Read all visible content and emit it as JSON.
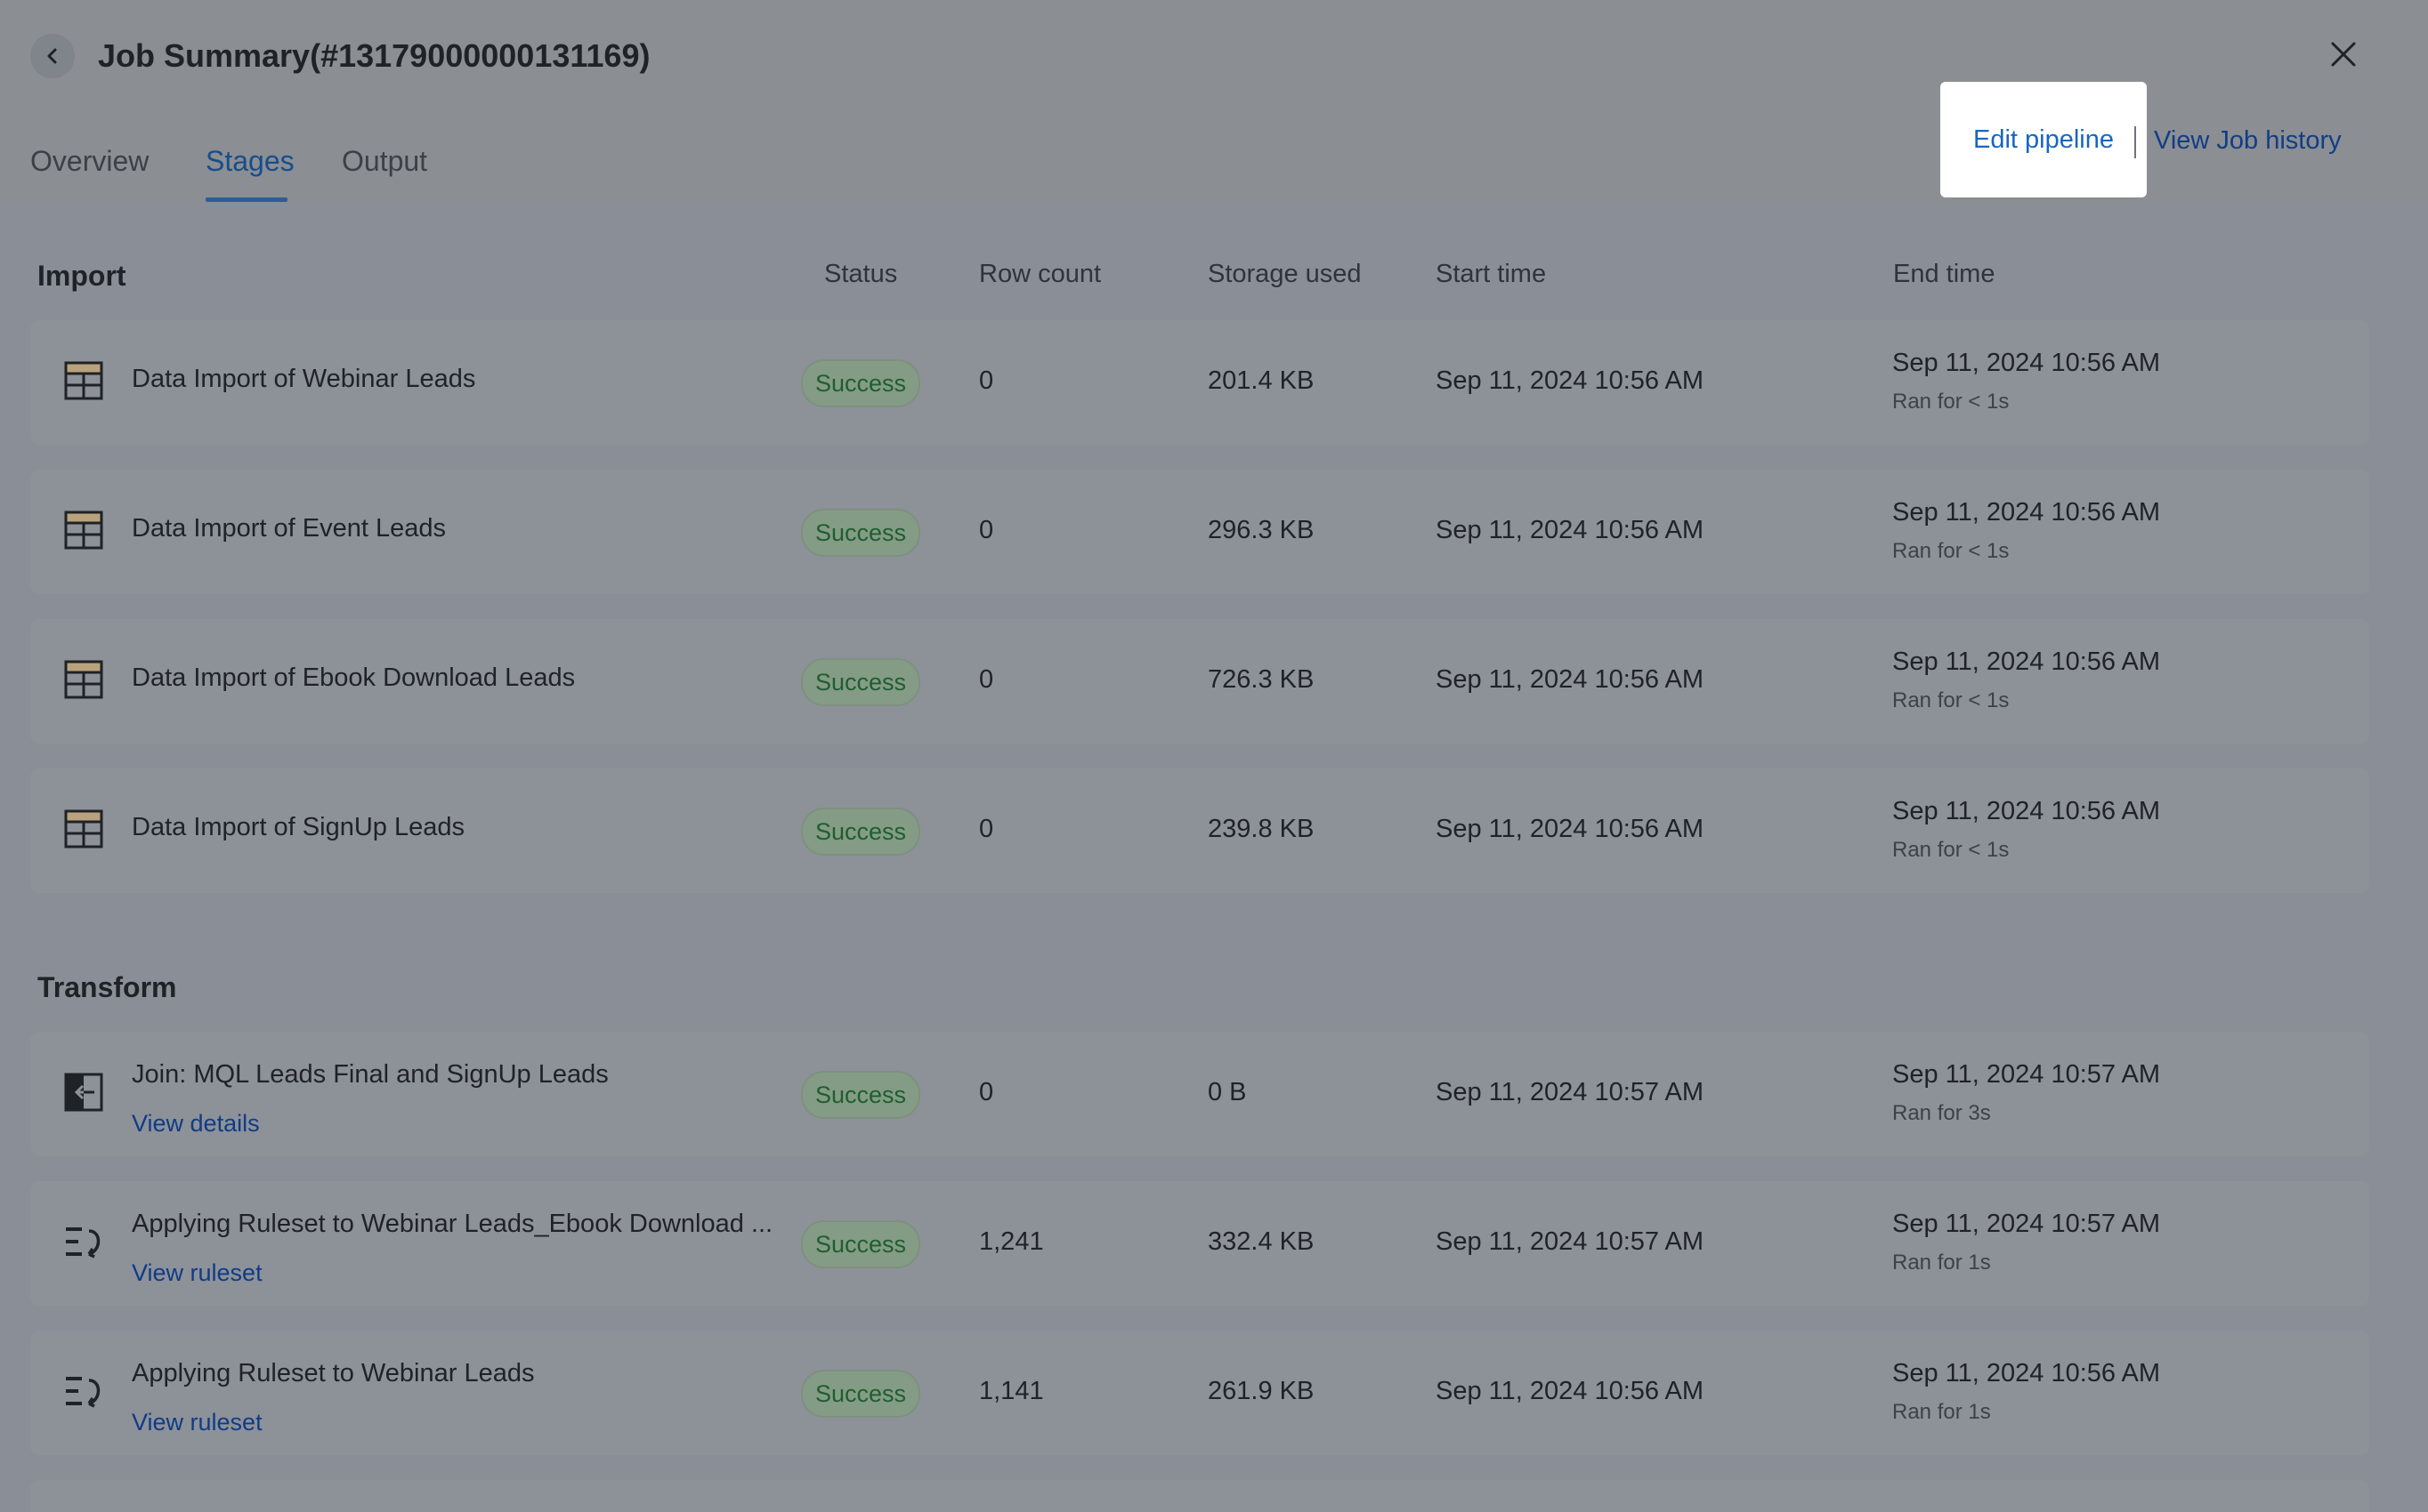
{
  "header": {
    "title": "Job Summary(#13179000000131169)",
    "tabs": [
      "Overview",
      "Stages",
      "Output"
    ],
    "active_tab": "Stages",
    "edit_pipeline": "Edit pipeline",
    "view_job_history": "View Job history"
  },
  "columns": {
    "status": "Status",
    "row_count": "Row count",
    "storage_used": "Storage used",
    "start_time": "Start time",
    "end_time": "End time"
  },
  "import": {
    "title": "Import",
    "rows": [
      {
        "icon": "table-icon",
        "name": "Data Import of Webinar Leads",
        "status": "Success",
        "row_count": "0",
        "storage": "201.4 KB",
        "start": "Sep 11, 2024 10:56 AM",
        "end": "Sep 11, 2024 10:56 AM",
        "ran_for": "Ran for < 1s"
      },
      {
        "icon": "table-icon",
        "name": "Data Import of Event Leads",
        "status": "Success",
        "row_count": "0",
        "storage": "296.3 KB",
        "start": "Sep 11, 2024 10:56 AM",
        "end": "Sep 11, 2024 10:56 AM",
        "ran_for": "Ran for < 1s"
      },
      {
        "icon": "table-icon",
        "name": "Data Import of Ebook Download Leads",
        "status": "Success",
        "row_count": "0",
        "storage": "726.3 KB",
        "start": "Sep 11, 2024 10:56 AM",
        "end": "Sep 11, 2024 10:56 AM",
        "ran_for": "Ran for < 1s"
      },
      {
        "icon": "table-icon",
        "name": "Data Import of SignUp Leads",
        "status": "Success",
        "row_count": "0",
        "storage": "239.8 KB",
        "start": "Sep 11, 2024 10:56 AM",
        "end": "Sep 11, 2024 10:56 AM",
        "ran_for": "Ran for < 1s"
      }
    ]
  },
  "transform": {
    "title": "Transform",
    "rows": [
      {
        "icon": "join-icon",
        "name": "Join: MQL Leads Final and SignUp Leads",
        "link": "View details",
        "status": "Success",
        "row_count": "0",
        "storage": "0 B",
        "start": "Sep 11, 2024 10:57 AM",
        "end": "Sep 11, 2024 10:57 AM",
        "ran_for": "Ran for 3s"
      },
      {
        "icon": "ruleset-icon",
        "name": "Applying Ruleset to Webinar Leads_Ebook Download ...",
        "link": "View ruleset",
        "status": "Success",
        "row_count": "1,241",
        "storage": "332.4 KB",
        "start": "Sep 11, 2024 10:57 AM",
        "end": "Sep 11, 2024 10:57 AM",
        "ran_for": "Ran for 1s"
      },
      {
        "icon": "ruleset-icon",
        "name": "Applying Ruleset to Webinar Leads",
        "link": "View ruleset",
        "status": "Success",
        "row_count": "1,141",
        "storage": "261.9 KB",
        "start": "Sep 11, 2024 10:56 AM",
        "end": "Sep 11, 2024 10:56 AM",
        "ran_for": "Ran for 1s"
      }
    ]
  }
}
